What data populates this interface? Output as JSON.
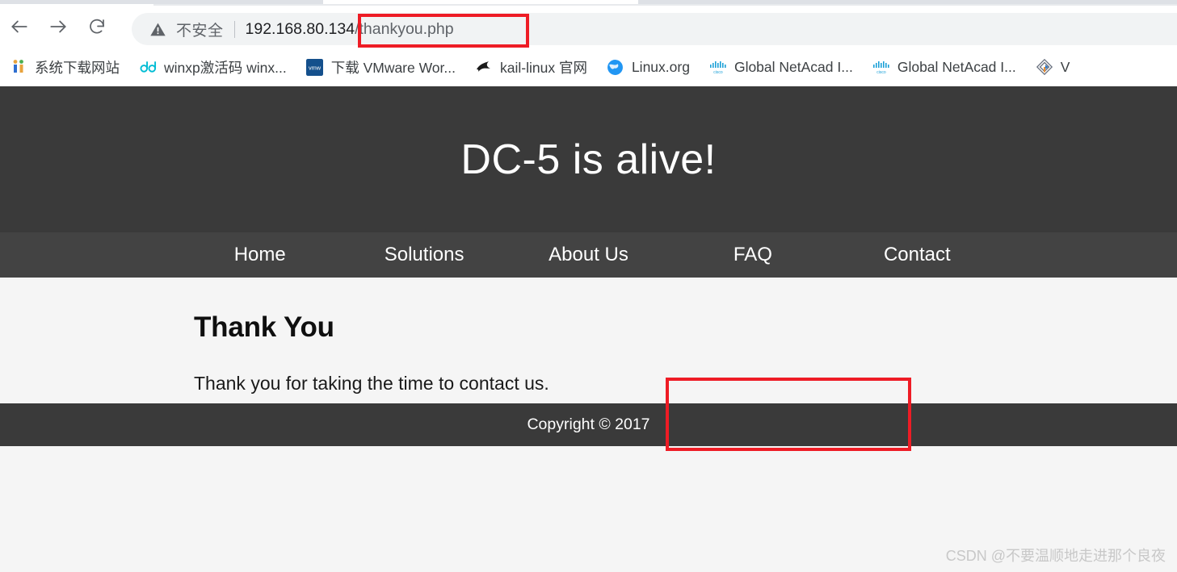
{
  "browser": {
    "back_label": "Back",
    "forward_label": "Forward",
    "reload_label": "Reload",
    "security_text": "不安全",
    "url_host": "192.168.80.134",
    "url_path": "/thankyou.php",
    "url_full": "192.168.80.134/thankyou.php",
    "bookmarks": [
      {
        "label": "系统下载网站",
        "icon": "bookmark-favicon-system-download"
      },
      {
        "label": "winxp激活码 winx...",
        "icon": "bookmark-favicon-dd"
      },
      {
        "label": "下载 VMware Wor...",
        "icon": "bookmark-favicon-vmware"
      },
      {
        "label": "kail-linux 官网",
        "icon": "bookmark-favicon-kali-dragon"
      },
      {
        "label": "Linux.org",
        "icon": "bookmark-favicon-globe"
      },
      {
        "label": "Global NetAcad I...",
        "icon": "bookmark-favicon-cisco"
      },
      {
        "label": "Global NetAcad I...",
        "icon": "bookmark-favicon-cisco"
      },
      {
        "label": "V",
        "icon": "bookmark-favicon-diamond"
      }
    ]
  },
  "page": {
    "hero_title": "DC-5 is alive!",
    "nav": [
      {
        "label": "Home"
      },
      {
        "label": "Solutions"
      },
      {
        "label": "About Us"
      },
      {
        "label": "FAQ"
      },
      {
        "label": "Contact"
      }
    ],
    "heading": "Thank You",
    "body_text": "Thank you for taking the time to contact us.",
    "footer_text": "Copyright © 2017"
  },
  "annotations": {
    "highlight_color": "#ee1c25",
    "url_box_target": "/thankyou.php",
    "footer_box_target": "Copyright © 2017"
  },
  "watermark": {
    "text": "CSDN @不要温顺地走进那个良夜"
  },
  "colors": {
    "hero_bg": "#3a3a3a",
    "nav_bg": "#434343",
    "footer_bg": "#3a3a3a",
    "page_bg": "#f5f5f5",
    "annotation_red": "#ee1c25"
  }
}
